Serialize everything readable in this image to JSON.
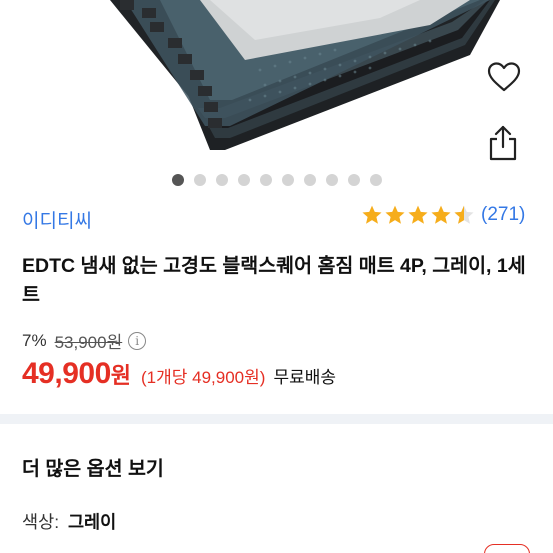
{
  "product_image": {
    "alt": "블랙스퀘어 홈짐 매트 4P 그레이",
    "carousel_count": 10,
    "active_index": 0
  },
  "actions": {
    "wishlist_icon": "heart-icon",
    "share_icon": "share-icon"
  },
  "brand": "이디티씨",
  "rating": {
    "stars": 4.5,
    "review_count": "(271)",
    "star_color": "#f6ad1b"
  },
  "title": "EDTC 냄새 없는 고경도 블랙스퀘어 홈짐 매트 4P, 그레이, 1세트",
  "price": {
    "discount": "7%",
    "original": "53,900원",
    "sale_number": "49,900",
    "sale_unit": "원",
    "unit_price": "(1개당 49,900원)",
    "shipping": "무료배송",
    "accent_color": "#e52f24"
  },
  "options": {
    "more_label": "더 많은 옵션 보기",
    "color_label": "색상:",
    "color_value": "그레이"
  }
}
